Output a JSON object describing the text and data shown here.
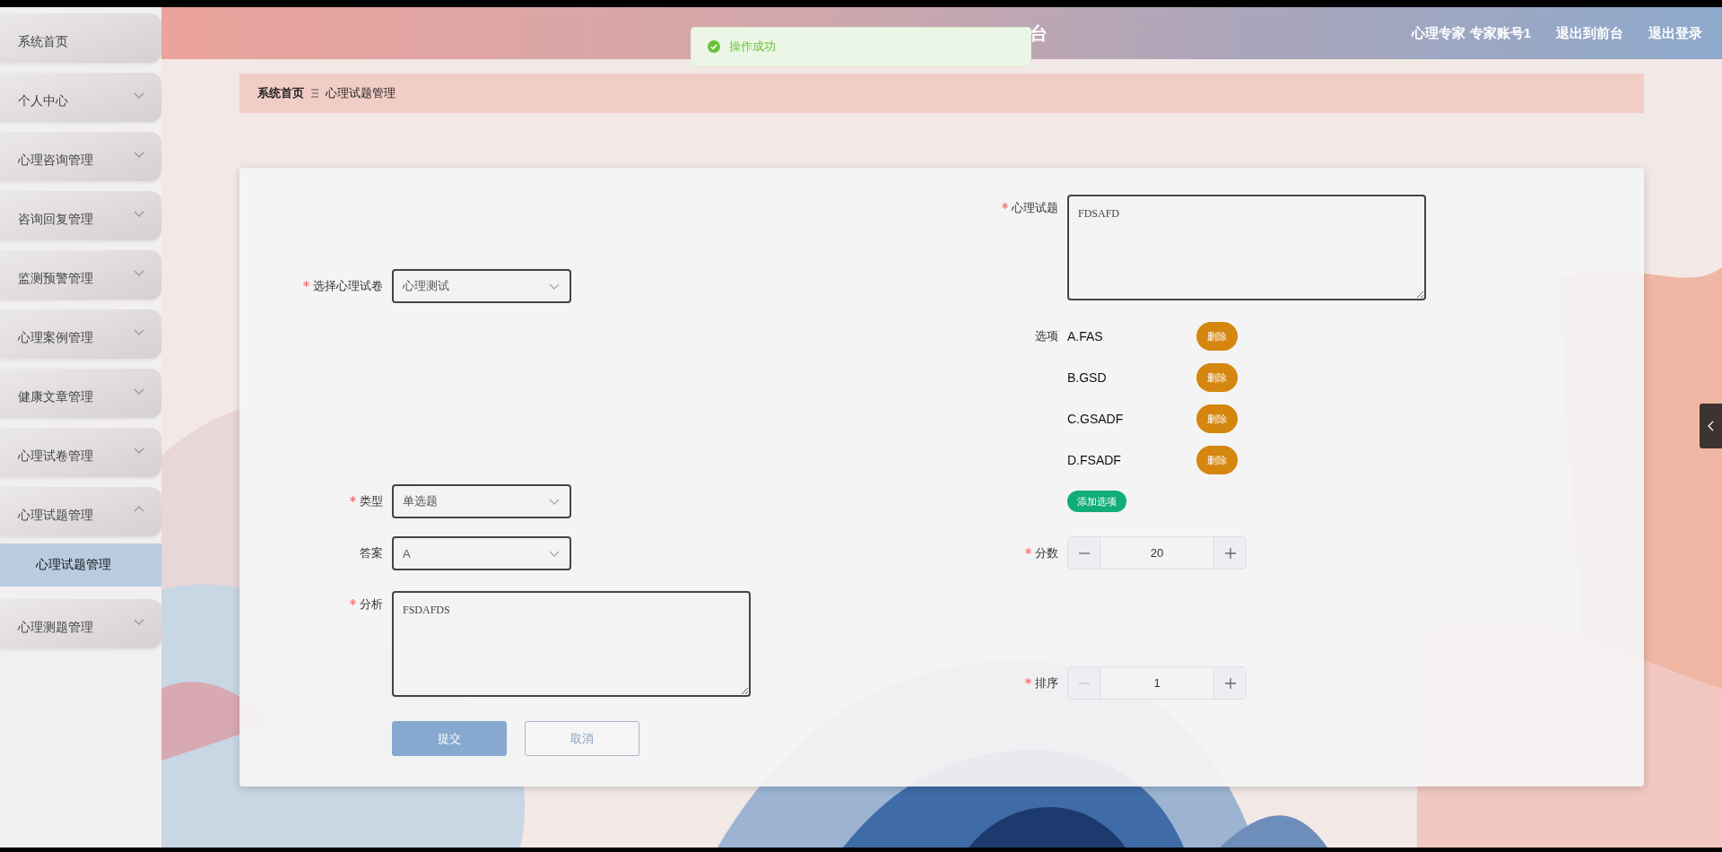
{
  "sidebar": {
    "items": [
      {
        "label": "系统首页",
        "kind": "link"
      },
      {
        "label": "个人中心",
        "kind": "submenu",
        "expanded": false
      },
      {
        "label": "心理咨询管理",
        "kind": "submenu",
        "expanded": false
      },
      {
        "label": "咨询回复管理",
        "kind": "submenu",
        "expanded": false
      },
      {
        "label": "监测预警管理",
        "kind": "submenu",
        "expanded": false
      },
      {
        "label": "心理案例管理",
        "kind": "submenu",
        "expanded": false
      },
      {
        "label": "健康文章管理",
        "kind": "submenu",
        "expanded": false
      },
      {
        "label": "心理试卷管理",
        "kind": "submenu",
        "expanded": false
      },
      {
        "label": "心理试题管理",
        "kind": "submenu",
        "expanded": true,
        "children": [
          {
            "label": "心理试题管理",
            "selected": true
          }
        ]
      },
      {
        "label": "心理测题管理",
        "kind": "submenu",
        "expanded": false
      }
    ]
  },
  "header": {
    "title": "台",
    "links": [
      "心理专家 专家账号1",
      "退出到前台",
      "退出登录"
    ]
  },
  "toast": {
    "kind": "success",
    "message": "操作成功"
  },
  "breadcrumb": [
    "系统首页",
    "心理试题管理"
  ],
  "form": {
    "left": [
      {
        "label": "选择心理试卷",
        "required": true,
        "kind": "select",
        "value": "心理测试"
      },
      {
        "label": "类型",
        "required": true,
        "kind": "select",
        "value": "单选题"
      },
      {
        "label": "答案",
        "required": false,
        "kind": "select",
        "value": "A"
      },
      {
        "label": "分析",
        "required": true,
        "kind": "textarea",
        "value": "FSDAFDS"
      }
    ],
    "buttons": [
      {
        "label": "提交",
        "kind": "primary"
      },
      {
        "label": "取消",
        "kind": "secondary"
      }
    ],
    "question": {
      "label": "心理试题",
      "required": true,
      "value": "FDSAFD"
    },
    "options": {
      "label": "选项",
      "items": [
        {
          "text": "A.FAS",
          "button": "删除"
        },
        {
          "text": "B.GSD",
          "button": "删除"
        },
        {
          "text": "C.GSADF",
          "button": "删除"
        },
        {
          "text": "D.FSADF",
          "button": "删除"
        }
      ],
      "add_button": "添加选项"
    },
    "numbers": [
      {
        "label": "分数",
        "required": true,
        "value": "20",
        "min_disabled": false
      },
      {
        "label": "排序",
        "required": true,
        "value": "1",
        "min_disabled": true
      }
    ]
  }
}
